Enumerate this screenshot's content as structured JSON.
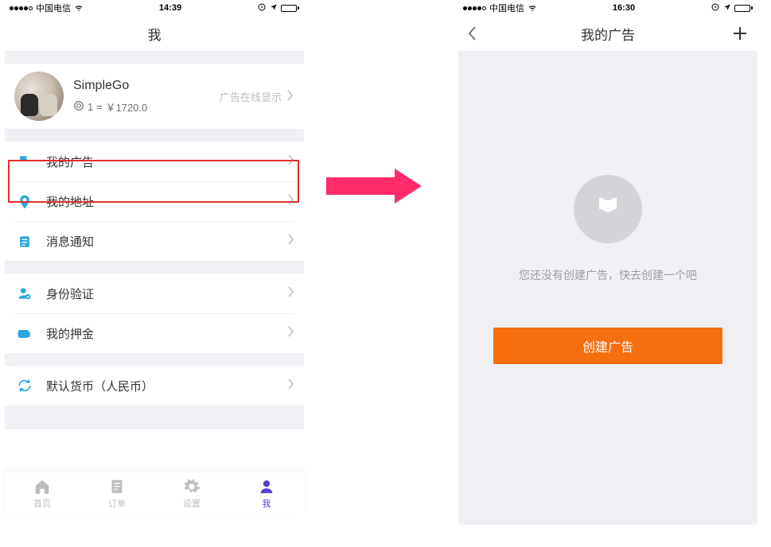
{
  "left": {
    "status": {
      "carrier": "中国电信",
      "time": "14:39"
    },
    "header_title": "我",
    "profile": {
      "name": "SimpleGo",
      "balance_prefix": "1 =",
      "balance": "￥1720.0",
      "right_text": "广告在线显示"
    },
    "group1": [
      {
        "label": "我的广告",
        "icon": "flag-icon"
      },
      {
        "label": "我的地址",
        "icon": "pin-icon"
      },
      {
        "label": "消息通知",
        "icon": "doc-icon"
      }
    ],
    "group2": [
      {
        "label": "身份验证",
        "icon": "id-icon"
      },
      {
        "label": "我的押金",
        "icon": "deposit-icon"
      }
    ],
    "group3": [
      {
        "label": "默认货币（人民币）",
        "icon": "refresh-icon"
      }
    ],
    "tabs": [
      {
        "label": "首页"
      },
      {
        "label": "订单"
      },
      {
        "label": "设置"
      },
      {
        "label": "我"
      }
    ]
  },
  "right": {
    "status": {
      "carrier": "中国电信",
      "time": "16:30"
    },
    "header_title": "我的广告",
    "empty_text": "您还没有创建广告，快去创建一个吧",
    "create_label": "创建广告"
  }
}
